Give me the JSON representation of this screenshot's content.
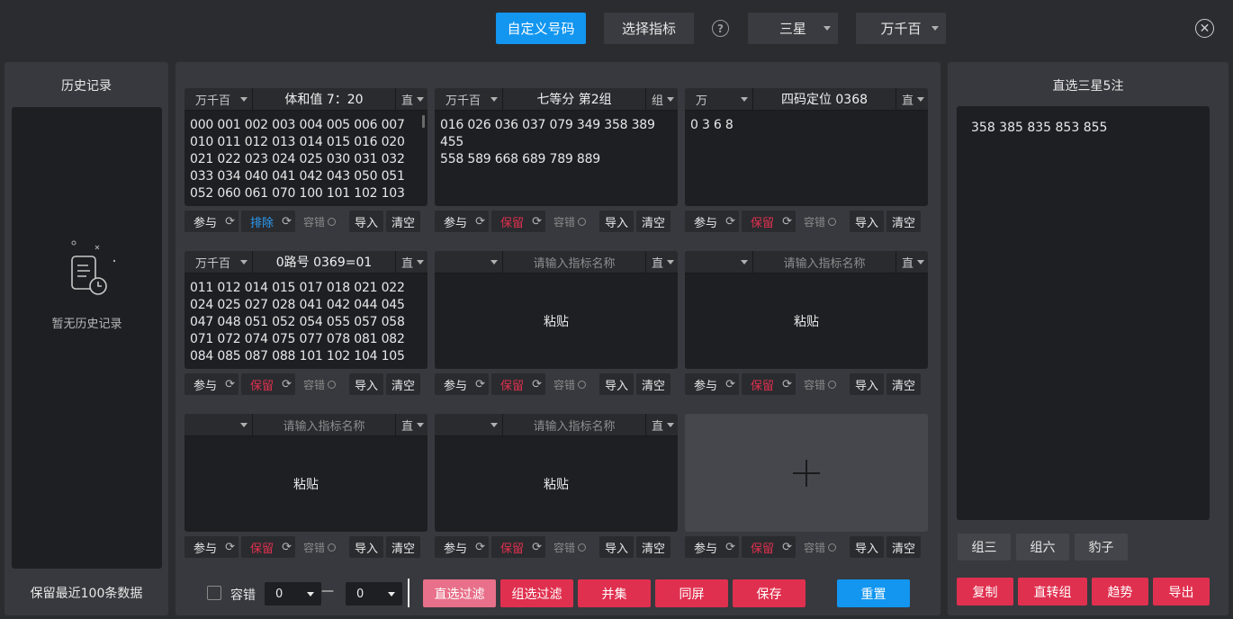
{
  "top": {
    "btn_custom": "自定义号码",
    "btn_select": "选择指标",
    "help": "?",
    "sel_star": "三星",
    "sel_pos": "万千百",
    "close": "✕"
  },
  "history": {
    "title": "历史记录",
    "empty": "暂无历史记录",
    "footer": "保留最近100条数据"
  },
  "cards": [
    {
      "pos": "万千百",
      "name": "体和值 7：20",
      "mode": "直",
      "content": "000 001 002 003 004 005 006 007\n010 011 012 013 014 015 016 020\n021 022 023 024 025 030 031 032\n033 034 040 041 042 043 050 051\n052 060 061 070 100 101 102 103",
      "c1": "参与",
      "c2": "排除",
      "c3": "容错",
      "c4": "导入",
      "c5": "清空"
    },
    {
      "pos": "万千百",
      "name": "七等分 第2组",
      "mode": "组",
      "content": "016 026 036 037 079 349 358 389 455\n558 589 668 689 789 889",
      "c1": "参与",
      "c2": "保留",
      "c3": "容错",
      "c4": "导入",
      "c5": "清空"
    },
    {
      "pos": "万",
      "name": "四码定位 0368",
      "mode": "直",
      "content": "0 3 6 8",
      "c1": "参与",
      "c2": "保留",
      "c3": "容错",
      "c4": "导入",
      "c5": "清空"
    },
    {
      "pos": "万千百",
      "name": "0路号 0369=01",
      "mode": "直",
      "content": "011 012 014 015 017 018 021 022\n024 025 027 028 041 042 044 045\n047 048 051 052 054 055 057 058\n071 072 074 075 077 078 081 082\n084 085 087 088 101 102 104 105",
      "c1": "参与",
      "c2": "保留",
      "c3": "容错",
      "c4": "导入",
      "c5": "清空"
    },
    {
      "pos": "",
      "placeholder": "请输入指标名称",
      "mode": "直",
      "paste": "粘贴",
      "c1": "参与",
      "c2": "保留",
      "c3": "容错",
      "c4": "导入",
      "c5": "清空"
    },
    {
      "pos": "",
      "placeholder": "请输入指标名称",
      "mode": "直",
      "paste": "粘贴",
      "c1": "参与",
      "c2": "保留",
      "c3": "容错",
      "c4": "导入",
      "c5": "清空"
    },
    {
      "pos": "",
      "placeholder": "请输入指标名称",
      "mode": "直",
      "paste": "粘贴",
      "c1": "参与",
      "c2": "保留",
      "c3": "容错",
      "c4": "导入",
      "c5": "清空"
    },
    {
      "pos": "",
      "placeholder": "请输入指标名称",
      "mode": "直",
      "paste": "粘贴",
      "c1": "参与",
      "c2": "保留",
      "c3": "容错",
      "c4": "导入",
      "c5": "清空"
    },
    {
      "c1": "参与",
      "c2": "保留",
      "c3": "容错",
      "c4": "导入",
      "c5": "清空"
    }
  ],
  "bottom": {
    "tolerance": "容错",
    "min": "0",
    "dash": "—",
    "max": "0",
    "direct_filter": "直选过滤",
    "group_filter": "组选过滤",
    "union": "并集",
    "sync": "同屏",
    "save": "保存",
    "reset": "重置"
  },
  "result": {
    "title": "直选三星5注",
    "content": "358 385 835 853 855",
    "g3": "组三",
    "g6": "组六",
    "leopard": "豹子",
    "copy": "复制",
    "to_group": "直转组",
    "trend": "趋势",
    "export": "导出"
  },
  "colors": {
    "accent": "#1296f0",
    "danger": "#e0304f",
    "bg": "#2b2c30"
  }
}
